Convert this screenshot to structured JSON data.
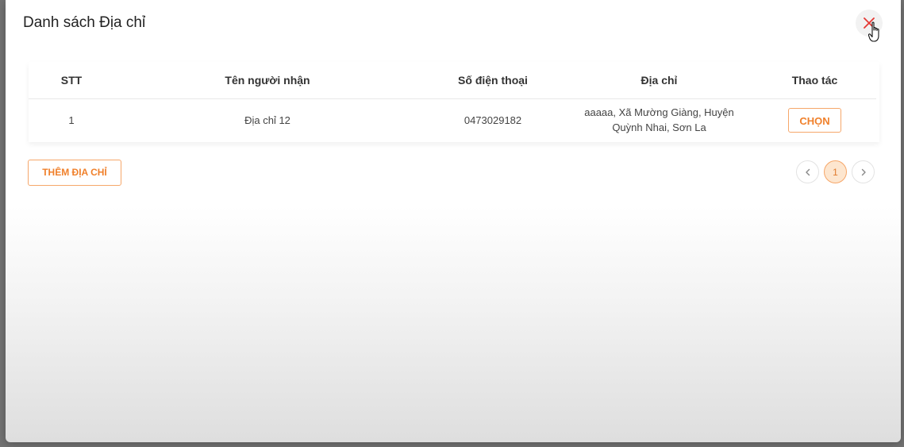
{
  "modal": {
    "title": "Danh sách Địa chỉ"
  },
  "table": {
    "headers": [
      "STT",
      "Tên người nhận",
      "Số điện thoại",
      "Địa chỉ",
      "Thao tác"
    ],
    "rows": [
      {
        "stt": "1",
        "name": "Địa chỉ 12",
        "phone": "0473029182",
        "address_line1": "aaaaa, Xã Mường Giàng, Huyện",
        "address_line2": "Quỳnh Nhai, Sơn La",
        "action_label": "CHỌN"
      }
    ]
  },
  "add_button_label": "THÊM ĐỊA CHỈ",
  "pagination": {
    "current_page": "1"
  },
  "colors": {
    "accent": "#f0802b",
    "accent_border": "#f6a76a",
    "close_icon": "#e53935"
  },
  "icons": [
    "close-icon",
    "hand-cursor-icon",
    "chevron-left-icon",
    "chevron-right-icon"
  ]
}
